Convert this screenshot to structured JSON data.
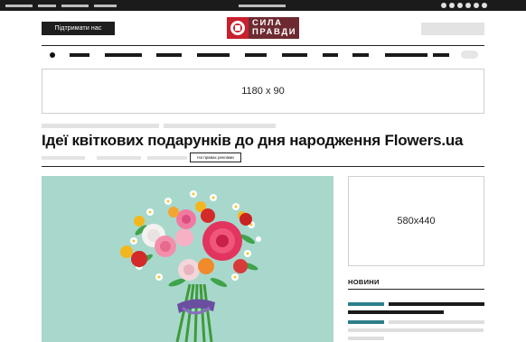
{
  "header": {
    "support_label": "Підтримати нас",
    "logo_line1": "СИЛА",
    "logo_line2": "ПРАВДИ"
  },
  "banner": {
    "label": "1180 x 90"
  },
  "article": {
    "title": "Ідеї квіткових подарунків до дня народження Flowers.ua",
    "ad_tag": "На правах реклами"
  },
  "sidebar": {
    "ad_label": "580x440",
    "news_title": "НОВИНИ"
  },
  "colors": {
    "topbar": "#1b1b1b",
    "logo_red": "#c8202e",
    "logo_maroon": "#6e2a31",
    "accent_teal": "#2c7f8c",
    "hero_bg": "#a8d8cc"
  },
  "icons": [
    "logo-mark-icon",
    "bouquet-illustration"
  ]
}
